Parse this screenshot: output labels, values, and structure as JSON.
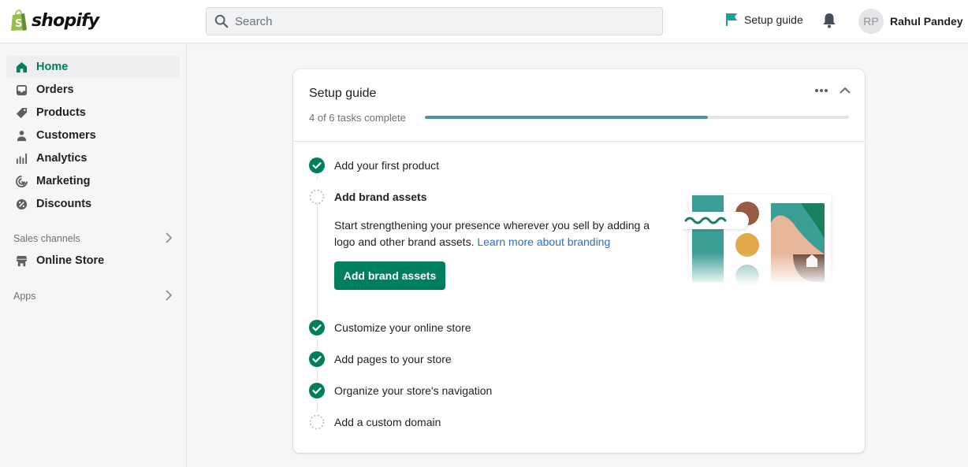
{
  "app": {
    "brand": "shopify",
    "colors": {
      "accent": "#007f5f",
      "progress": "#4f969b",
      "link": "#2c6ecb",
      "flag": "#1a9ea0"
    }
  },
  "topbar": {
    "search": {
      "placeholder": "Search",
      "value": "",
      "icon": "search-icon"
    },
    "setup_guide": {
      "label": "Setup guide",
      "icon": "flag-icon"
    },
    "notifications": {
      "icon": "bell-icon"
    },
    "user": {
      "initials": "RP",
      "name": "Rahul Pandey"
    }
  },
  "sidebar": {
    "items": [
      {
        "label": "Home",
        "icon": "home-icon",
        "active": true
      },
      {
        "label": "Orders",
        "icon": "orders-icon"
      },
      {
        "label": "Products",
        "icon": "tag-icon"
      },
      {
        "label": "Customers",
        "icon": "person-icon"
      },
      {
        "label": "Analytics",
        "icon": "bar-chart-icon"
      },
      {
        "label": "Marketing",
        "icon": "target-icon"
      },
      {
        "label": "Discounts",
        "icon": "discount-icon"
      }
    ],
    "sales_channels": {
      "title": "Sales channels",
      "items": [
        {
          "label": "Online Store",
          "icon": "store-icon"
        }
      ]
    },
    "apps": {
      "title": "Apps"
    }
  },
  "setup_card": {
    "title": "Setup guide",
    "progress_label": "4 of 6 tasks complete",
    "completed": 4,
    "total": 6,
    "tasks": [
      {
        "label": "Add your first product",
        "done": true
      },
      {
        "label": "Add brand assets",
        "done": false,
        "expanded": true,
        "description": "Start strengthening your presence wherever you sell by adding a logo and other brand assets.",
        "link": "Learn more about branding",
        "button": "Add brand assets"
      },
      {
        "label": "Customize your online store",
        "done": true
      },
      {
        "label": "Add pages to your store",
        "done": true
      },
      {
        "label": "Organize your store's navigation",
        "done": true
      },
      {
        "label": "Add a custom domain",
        "done": false
      }
    ]
  }
}
